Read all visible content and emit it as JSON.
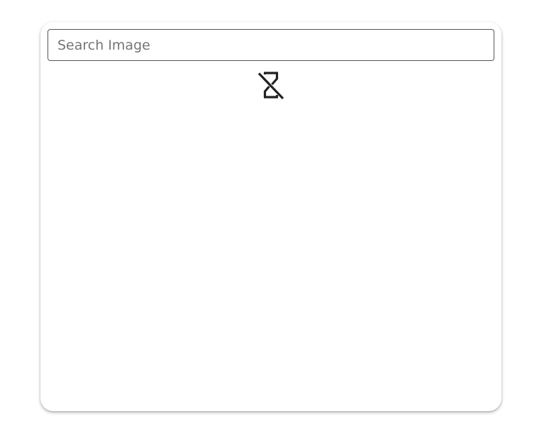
{
  "search": {
    "placeholder": "Search Image",
    "value": ""
  },
  "status": {
    "icon": "hourglass-disabled-icon"
  },
  "colors": {
    "panel_background": "#ffffff",
    "input_border": "#555555",
    "icon": "#222222"
  }
}
